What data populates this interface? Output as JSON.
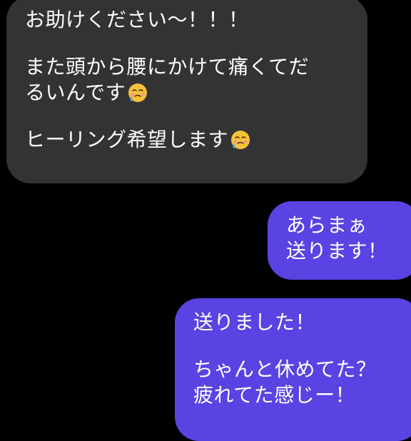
{
  "conversation": {
    "incoming": {
      "line1": "お助けください〜！！！",
      "line2": "また頭から腰にかけて痛くてだ",
      "line3": "るいんです",
      "line4": "ヒーリング希望します",
      "emoji": "face-holding-back-tears-emoji"
    },
    "outgoing_1": {
      "line1": "あらまぁ",
      "line2": "送ります！"
    },
    "outgoing_2": {
      "line1": "送りました！",
      "line2": "ちゃんと休めてた？",
      "line3": "疲れてた感じー！"
    }
  },
  "colors": {
    "background": "#000000",
    "incoming_bubble": "#333333",
    "outgoing_bubble": "#5744e3",
    "text": "#ffffff",
    "emoji_face": "#f7c23a",
    "emoji_tear": "#4aa8e8"
  }
}
